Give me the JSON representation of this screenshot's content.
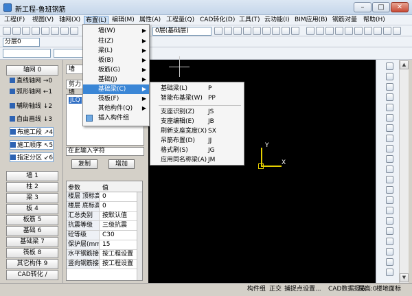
{
  "window": {
    "title": "新工程-鲁班钢筋",
    "min": "–",
    "max": "□",
    "close": "✕"
  },
  "menu": [
    "工程(F)",
    "视图(V)",
    "轴网(X)",
    "布置(L)",
    "编辑(M)",
    "属性(A)",
    "工程量(Q)",
    "CAD转化(D)",
    "工具(T)",
    "云功能(I)",
    "BIM应用(B)",
    "钢筋对量",
    "帮助(H)"
  ],
  "toolbar": {
    "layer_select": "0层(基础层)"
  },
  "toolbar2": {
    "floor_select": "分层0"
  },
  "left_panel": {
    "axis_header": "轴网 0",
    "axis_items": [
      {
        "label": "直线轴网",
        "key": "→0"
      },
      {
        "label": "弧形轴网",
        "key": "←1"
      },
      {
        "label": "辅助轴线",
        "key": "↓2"
      },
      {
        "label": "自由画线",
        "key": "↓3"
      },
      {
        "label": "布施工段",
        "key": "↗4"
      },
      {
        "label": "施工顺序",
        "key": "↖5"
      },
      {
        "label": "指定分区",
        "key": "↙6"
      }
    ],
    "categories": [
      "墙 1",
      "柱 2",
      "梁 3",
      "板 4",
      "板筋 5",
      "基础 6",
      "基础梁 7",
      "筏板 8",
      "其它构件 9",
      "CAD转化 /"
    ]
  },
  "mid_panel": {
    "tab1": "墙",
    "tab2": "剪力墙",
    "list_item": "JLQ",
    "input": "在此输入字符",
    "copy": "复制",
    "add": "增加",
    "table_header": [
      "参数",
      "值"
    ],
    "rows": [
      {
        "k": "楼层 顶标高",
        "v": "0"
      },
      {
        "k": "楼层 底标高",
        "v": "0"
      },
      {
        "k": "汇总类别",
        "v": "按默认值"
      },
      {
        "k": "抗震等级",
        "v": "三级抗震"
      },
      {
        "k": "砼等级",
        "v": "C30"
      },
      {
        "k": "保护层(mm)",
        "v": "15"
      },
      {
        "k": "水平钢筋接头",
        "v": "按工程设置"
      },
      {
        "k": "竖向钢筋接头",
        "v": "按工程设置"
      }
    ]
  },
  "layout_menu": {
    "items": [
      "墙(W)",
      "柱(Z)",
      "梁(L)",
      "板(B)",
      "板筋(G)",
      "基础(J)",
      "基础梁(C)",
      "筏板(F)",
      "其他构件(Q)",
      "插入构件组"
    ]
  },
  "foundation_submenu": {
    "items": [
      {
        "label": "基础梁(L)",
        "shortcut": "P"
      },
      {
        "label": "智能布基梁(W)",
        "shortcut": "PP"
      },
      {
        "label": "支座识别(Z)",
        "shortcut": "JS"
      },
      {
        "label": "支座编辑(E)",
        "shortcut": "JB"
      },
      {
        "label": "刷新支座宽度(X)",
        "shortcut": "SX"
      },
      {
        "label": "吊筋布置(D)",
        "shortcut": "JJ"
      },
      {
        "label": "格式刷(S)",
        "shortcut": "JG"
      },
      {
        "label": "应用同名称梁(A)",
        "shortcut": "JM"
      }
    ]
  },
  "canvas": {
    "y_label": "Y",
    "x_label": "X"
  },
  "status": [
    "构件组",
    "正交",
    "捕捉点设置...",
    "CAD数据提取",
    "层高:0",
    "楼地面标"
  ]
}
